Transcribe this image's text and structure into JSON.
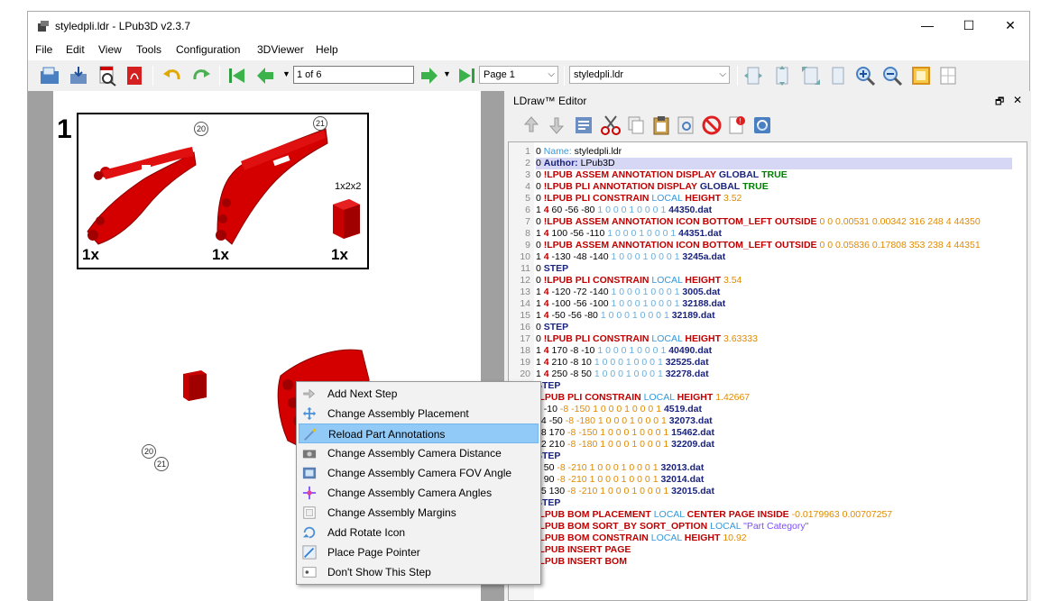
{
  "window": {
    "title": "styledpli.ldr - LPub3D v2.3.7",
    "minimize": "—",
    "maximize": "☐",
    "close": "✕"
  },
  "menu": [
    "File",
    "Edit",
    "View",
    "Tools",
    "Configuration",
    "3DViewer",
    "Help"
  ],
  "toolbar": {
    "page_field": "1 of 6",
    "page_combo": "Page 1",
    "file_combo": "styledpli.ldr"
  },
  "view": {
    "step_number": "1",
    "pli": {
      "annotations": [
        "20",
        "21"
      ],
      "size_label": "1x2x2",
      "quantities": [
        "1x",
        "1x",
        "1x"
      ]
    },
    "assembly_annotations": [
      "20",
      "21"
    ]
  },
  "editor": {
    "title": "LDraw™ Editor",
    "float_icon": "🗗",
    "close_icon": "✕",
    "lines": [
      {
        "n": "1",
        "text": "0 Name: styledpli.ldr"
      },
      {
        "n": "2",
        "text": "0 Author: LPub3D"
      },
      {
        "n": "3",
        "text": "0 !LPUB ASSEM ANNOTATION DISPLAY GLOBAL TRUE"
      },
      {
        "n": "4",
        "text": "0 !LPUB PLI ANNOTATION DISPLAY GLOBAL TRUE"
      },
      {
        "n": "5",
        "text": "0 !LPUB PLI CONSTRAIN LOCAL HEIGHT 3.52"
      },
      {
        "n": "6",
        "text": "1 4 60 -56 -80 1 0 0 0 1 0 0 0 1 44350.dat"
      },
      {
        "n": "7",
        "text": "0 !LPUB ASSEM ANNOTATION ICON BOTTOM_LEFT OUTSIDE 0 0 0.00531 0.00342 316 248 4 44350"
      },
      {
        "n": "8",
        "text": "1 4 100 -56 -110 1 0 0 0 1 0 0 0 1 44351.dat"
      },
      {
        "n": "9",
        "text": "0 !LPUB ASSEM ANNOTATION ICON BOTTOM_LEFT OUTSIDE 0 0 0.05836 0.17808 353 238 4 44351"
      },
      {
        "n": "10",
        "text": "1 4 -130 -48 -140 1 0 0 0 1 0 0 0 1 3245a.dat"
      },
      {
        "n": "11",
        "text": "0 STEP"
      },
      {
        "n": "12",
        "text": "0 !LPUB PLI CONSTRAIN LOCAL HEIGHT 3.54"
      },
      {
        "n": "13",
        "text": "1 4 -120 -72 -140 1 0 0 0 1 0 0 0 1 3005.dat"
      },
      {
        "n": "14",
        "text": "1 4 -100 -56 -100 1 0 0 0 1 0 0 0 1 32188.dat"
      },
      {
        "n": "15",
        "text": "1 4 -50 -56 -80 1 0 0 0 1 0 0 0 1 32189.dat"
      },
      {
        "n": "16",
        "text": "0 STEP"
      },
      {
        "n": "17",
        "text": "0 !LPUB PLI CONSTRAIN LOCAL HEIGHT 3.63333"
      },
      {
        "n": "18",
        "text": "1 4 170 -8 -10 1 0 0 0 1 0 0 0 1 40490.dat"
      },
      {
        "n": "19",
        "text": "1 4 210 -8 10 1 0 0 0 1 0 0 0 1 32525.dat"
      },
      {
        "n": "20",
        "text": "1 4 250 -8 50 1 0 0 0 1 0 0 0 1 32278.dat"
      },
      {
        "n": "",
        "text": "STEP"
      },
      {
        "n": "",
        "text": "!LPUB PLI CONSTRAIN LOCAL HEIGHT 1.42667"
      },
      {
        "n": "",
        "text": "4 -10 -8 -150 1 0 0 0 1 0 0 0 1 4519.dat"
      },
      {
        "n": "",
        "text": "14 -50 -8 -180 1 0 0 0 1 0 0 0 1 32073.dat"
      },
      {
        "n": "",
        "text": "28 170 -8 -150 1 0 0 0 1 0 0 0 1 15462.dat"
      },
      {
        "n": "",
        "text": "72 210 -8 -180 1 0 0 0 1 0 0 0 1 32209.dat"
      },
      {
        "n": "",
        "text": "STEP"
      },
      {
        "n": "",
        "text": "7 50 -8 -210 1 0 0 0 1 0 0 0 1 32013.dat"
      },
      {
        "n": "",
        "text": "0 90 -8 -210 1 0 0 0 1 0 0 0 1 32014.dat"
      },
      {
        "n": "",
        "text": "15 130 -8 -210 1 0 0 0 1 0 0 0 1 32015.dat"
      },
      {
        "n": "",
        "text": "STEP"
      },
      {
        "n": "",
        "text": "!LPUB BOM PLACEMENT LOCAL CENTER PAGE INSIDE -0.0179963 0.00707257"
      },
      {
        "n": "",
        "text": "!LPUB BOM SORT_BY SORT_OPTION LOCAL \"Part Category\""
      },
      {
        "n": "",
        "text": "!LPUB BOM CONSTRAIN LOCAL HEIGHT 10.92"
      },
      {
        "n": "",
        "text": "!LPUB INSERT PAGE"
      },
      {
        "n": "",
        "text": "!LPUB INSERT BOM"
      }
    ]
  },
  "context_menu": {
    "items": [
      {
        "label": "Add Next Step",
        "icon": "next-step-icon"
      },
      {
        "label": "Change Assembly Placement",
        "icon": "move-icon"
      },
      {
        "label": "Reload Part Annotations",
        "icon": "wand-icon",
        "highlighted": true
      },
      {
        "label": "Change Assembly Camera Distance",
        "icon": "camera-icon"
      },
      {
        "label": "Change Assembly Camera FOV Angle",
        "icon": "fov-icon"
      },
      {
        "label": "Change Assembly Camera Angles",
        "icon": "angles-icon"
      },
      {
        "label": "Change Assembly Margins",
        "icon": "margins-icon"
      },
      {
        "label": "Add Rotate Icon",
        "icon": "rotate-icon"
      },
      {
        "label": "Place Page Pointer",
        "icon": "pointer-icon"
      },
      {
        "label": "Don't Show This Step",
        "icon": "hide-icon"
      }
    ]
  },
  "colors": {
    "part_red": "#d40000",
    "highlight": "#91c9f7",
    "keyword_red": "#c00000",
    "keyword_navy": "#1a237e",
    "keyword_green": "#008000",
    "keyword_blue": "#3399dd",
    "number_orange": "#e08a00"
  }
}
